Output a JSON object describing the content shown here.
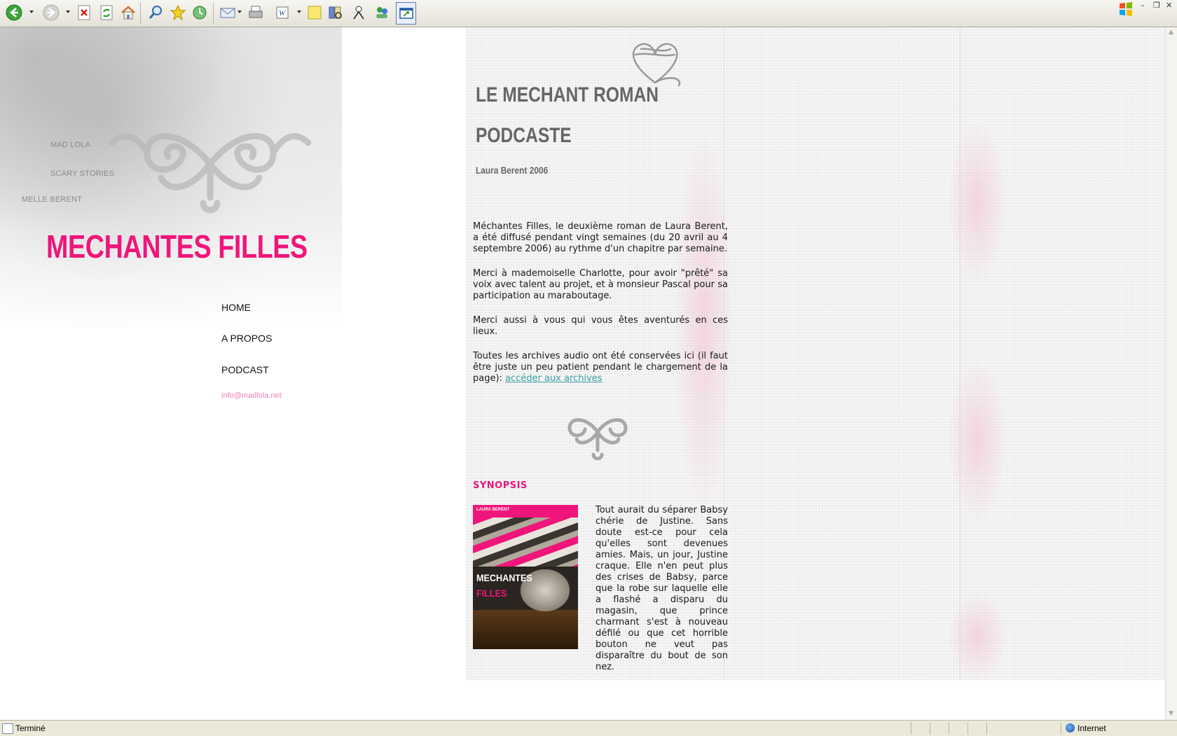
{
  "browser": {
    "toolbar_icons": [
      "back-icon",
      "forward-icon",
      "stop-icon",
      "refresh-icon",
      "home-icon",
      "search-icon",
      "favorites-icon",
      "history-icon",
      "mail-icon",
      "print-icon",
      "edit-icon",
      "notes-icon",
      "research-icon",
      "messenger-icon",
      "contacts-icon",
      "fullscreen-icon"
    ],
    "status_text": "Terminé",
    "zone_label": "Internet"
  },
  "side_links": [
    "MAD LOLA",
    "SCARY STORIES",
    "MELLE BERENT"
  ],
  "site_title": "MECHANTES FILLES",
  "nav": [
    "HOME",
    "A PROPOS",
    "PODCAST"
  ],
  "email": "info@madlola.net",
  "content": {
    "headline_line1": "LE MECHANT ROMAN",
    "headline_line2": "PODCASTE",
    "byline": "Laura Berent 2006",
    "para1": "Méchantes Filles, le deuxième roman de Laura Berent, a été diffusé pendant vingt semaines (du 20 avril au 4 septembre 2006) au rythme d'un chapitre par semaine.",
    "para2": "Merci à mademoiselle Charlotte, pour avoir \"prêté\" sa voix avec talent au projet, et à monsieur Pascal pour sa participation au maraboutage.",
    "para3": "Merci aussi à vous qui vous êtes aventurés en ces lieux.",
    "para4_prefix": "Toutes les archives audio ont été conservées ici (il faut être juste un peu patient pendant le chargement de la page): ",
    "archive_link": "accéder aux archives",
    "synopsis_heading": "SYNOPSIS",
    "cover_author": "LAURA BERENT",
    "cover_title_1": "MECHANTES",
    "cover_title_2": "FILLES",
    "synopsis_text": "Tout aurait du séparer Babsy chérie de Justine. Sans doute est-ce pour cela qu'elles sont devenues amies. Mais, un jour, Justine craque. Elle n'en peut plus des crises de Babsy, parce que la robe sur laquelle elle a flashé a disparu du magasin, que prince charmant s'est à nouveau défilé ou que cet horrible bouton ne veut pas disparaître du bout de son nez."
  },
  "colors": {
    "brand_pink": "#f0157a",
    "email_pink": "#f080b0",
    "link_teal": "#3aa0a8",
    "headline_gray": "#666666"
  }
}
